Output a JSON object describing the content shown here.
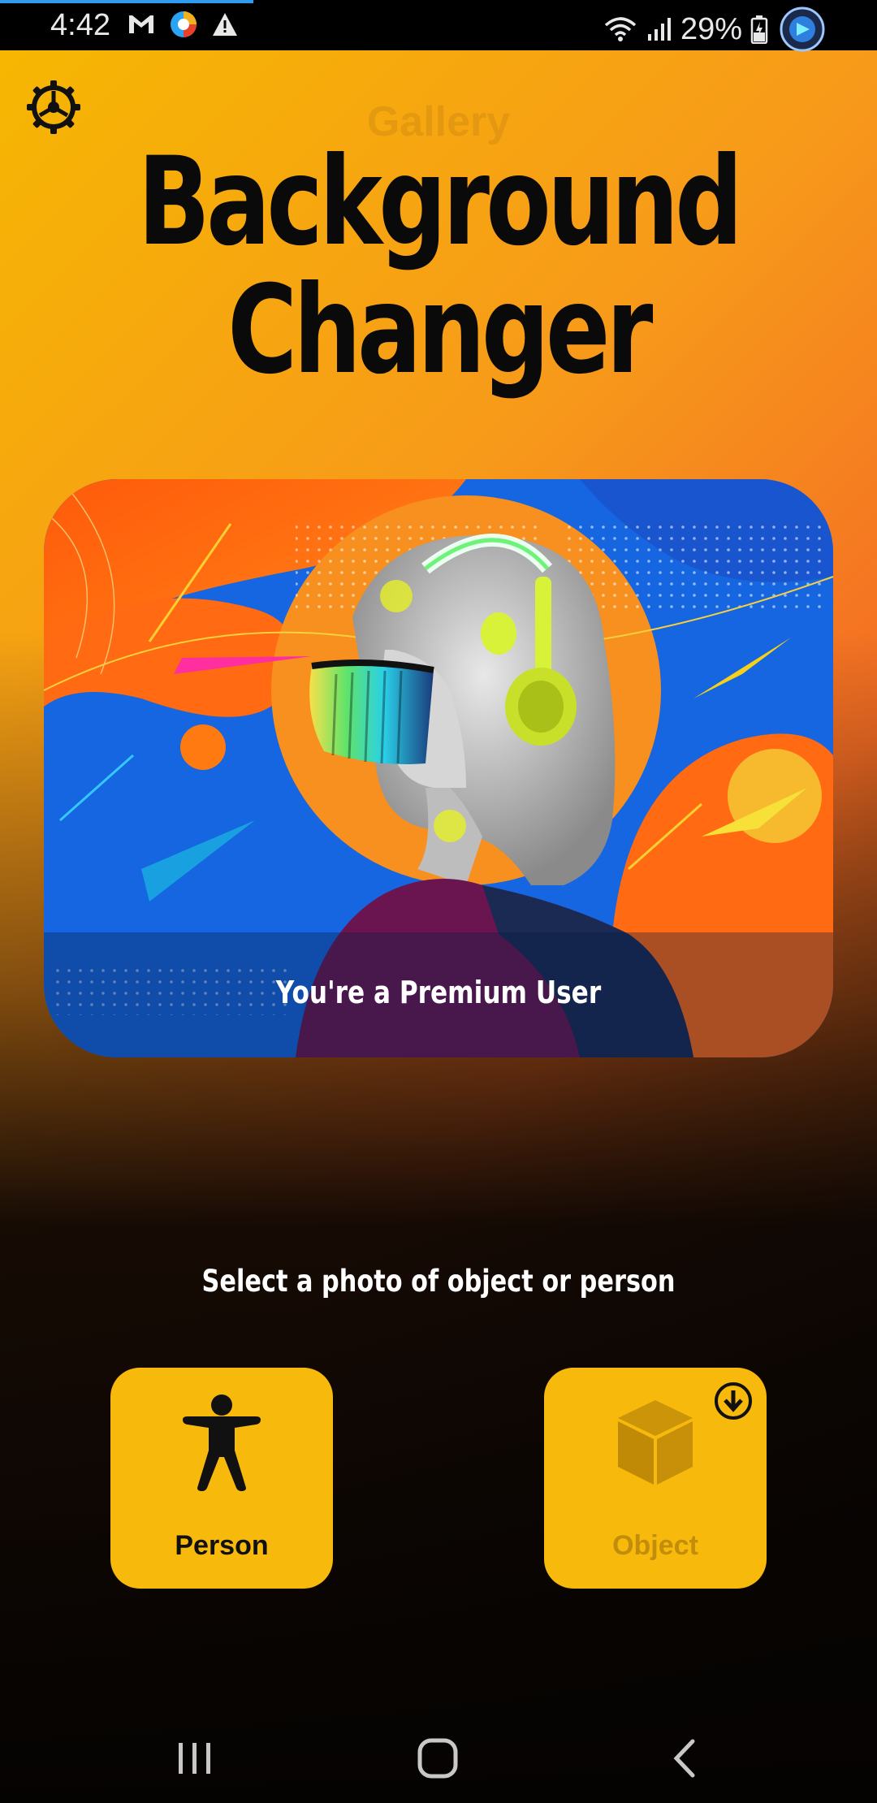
{
  "status_bar": {
    "time": "4:42",
    "battery_percent": "29%",
    "icons_left": [
      "gmail-icon",
      "app-colorful-icon",
      "warning-icon"
    ],
    "icons_right": [
      "wifi-icon",
      "signal-icon",
      "battery-icon",
      "app-overlay-icon"
    ]
  },
  "header": {
    "ghost_text": "Gallery",
    "title_line1": "Background",
    "title_line2": "Changer",
    "settings_icon": "gear-icon"
  },
  "hero": {
    "caption": "You're a Premium User"
  },
  "main": {
    "prompt": "Select a photo of object or person",
    "buttons": [
      {
        "label": "Person",
        "icon": "person-icon"
      },
      {
        "label": "Object",
        "icon": "cube-icon",
        "badge_icon": "download-icon"
      }
    ]
  },
  "nav": {
    "items": [
      "recent-apps-icon",
      "home-icon",
      "back-icon"
    ]
  },
  "colors": {
    "accent": "#f7b90b",
    "title": "#0a0a0a",
    "hero_blue": "#1566e0",
    "hero_orange": "#f76a14"
  }
}
